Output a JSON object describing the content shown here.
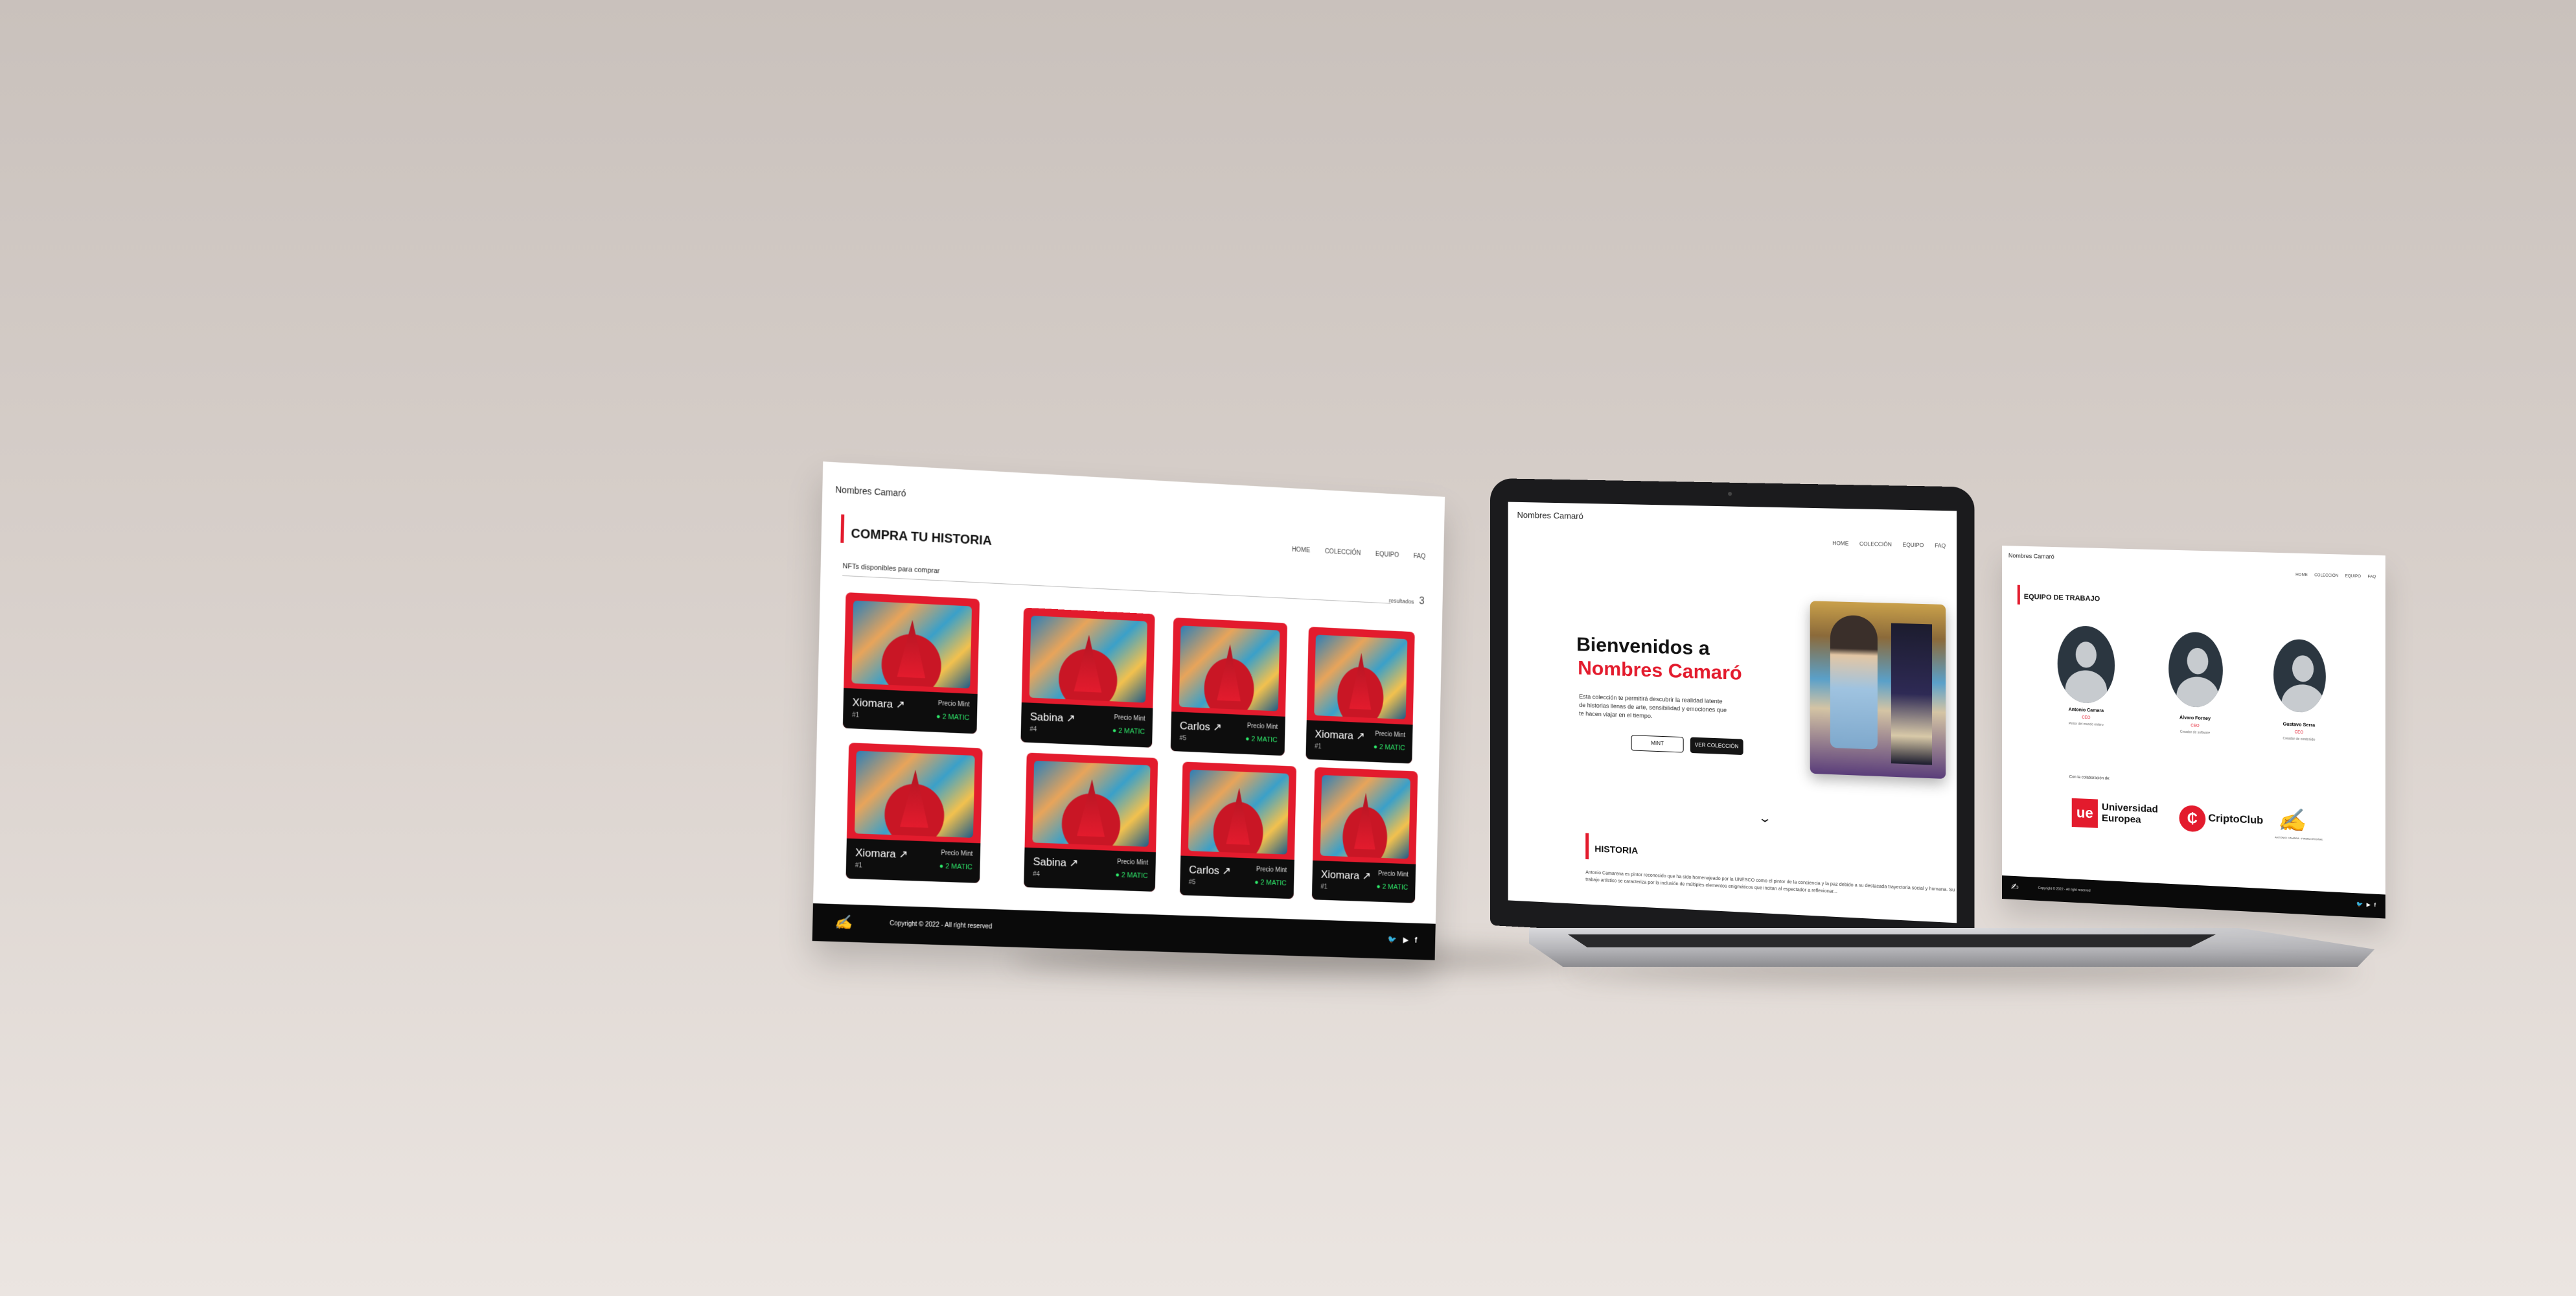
{
  "brand": "Nombres Camaró",
  "nav": [
    "HOME",
    "COLECCIÓN",
    "EQUIPO",
    "FAQ"
  ],
  "left": {
    "section_title": "COMPRA TU HISTORIA",
    "subtitle": "NFTs disponibles para comprar",
    "count_label": "resultados",
    "count_value": "3",
    "price_label": "Precio Mint",
    "cards": [
      {
        "name": "Xiomara",
        "num": "#1",
        "price": "2 MATIC"
      },
      {
        "name": "Sabina",
        "num": "#4",
        "price": "2 MATIC"
      },
      {
        "name": "Carlos",
        "num": "#5",
        "price": "2 MATIC"
      },
      {
        "name": "Xiomara",
        "num": "#1",
        "price": "2 MATIC"
      },
      {
        "name": "Xiomara",
        "num": "#1",
        "price": "2 MATIC"
      },
      {
        "name": "Sabina",
        "num": "#4",
        "price": "2 MATIC"
      },
      {
        "name": "Carlos",
        "num": "#5",
        "price": "2 MATIC"
      },
      {
        "name": "Xiomara",
        "num": "#1",
        "price": "2 MATIC"
      }
    ],
    "footer_copyright": "Copyright © 2022 - All right reserved"
  },
  "laptop": {
    "hero_line1": "Bienvenidos a",
    "hero_line2": "Nombres Camaró",
    "hero_text": "Esta colección te permitirá descubrir la realidad latente de historias llenas de arte, sensibilidad y emociones que te hacen viajar en el tiempo.",
    "btn_mint": "MINT",
    "btn_collection": "VER COLECCIÓN",
    "historia_title": "HISTORIA",
    "historia_text": "Antonio Camarena es pintor reconocido que ha sido homenajeado por la UNESCO como el pintor de la conciencia y la paz debido a su destacada trayectoria social y humana. Su trabajo artístico se caracteriza por la inclusión de múltiples elementos enigmáticos que incitan al espectador a reflexionar..."
  },
  "right": {
    "section_title": "EQUIPO DE TRABAJO",
    "team": [
      {
        "name": "Antonio Camara",
        "role": "CEO",
        "desc": "Pintor del mundo entero"
      },
      {
        "name": "Álvaro Forney",
        "role": "CEO",
        "desc": "Creador de software"
      },
      {
        "name": "Gustavo Serra",
        "role": "CEO",
        "desc": "Creador de contenido"
      }
    ],
    "collab_label": "Con la colaboración de:",
    "partners": [
      "Universidad Europea",
      "CriptoClub"
    ],
    "partner_badge": "ue",
    "partner_sub": "ANTONIO CAMARA · FIRMA ORIGINAL",
    "footer_copyright": "Copyright © 2022 - All right reserved"
  },
  "colors": {
    "accent": "#e31b2d",
    "price_green": "#2ee86a"
  }
}
